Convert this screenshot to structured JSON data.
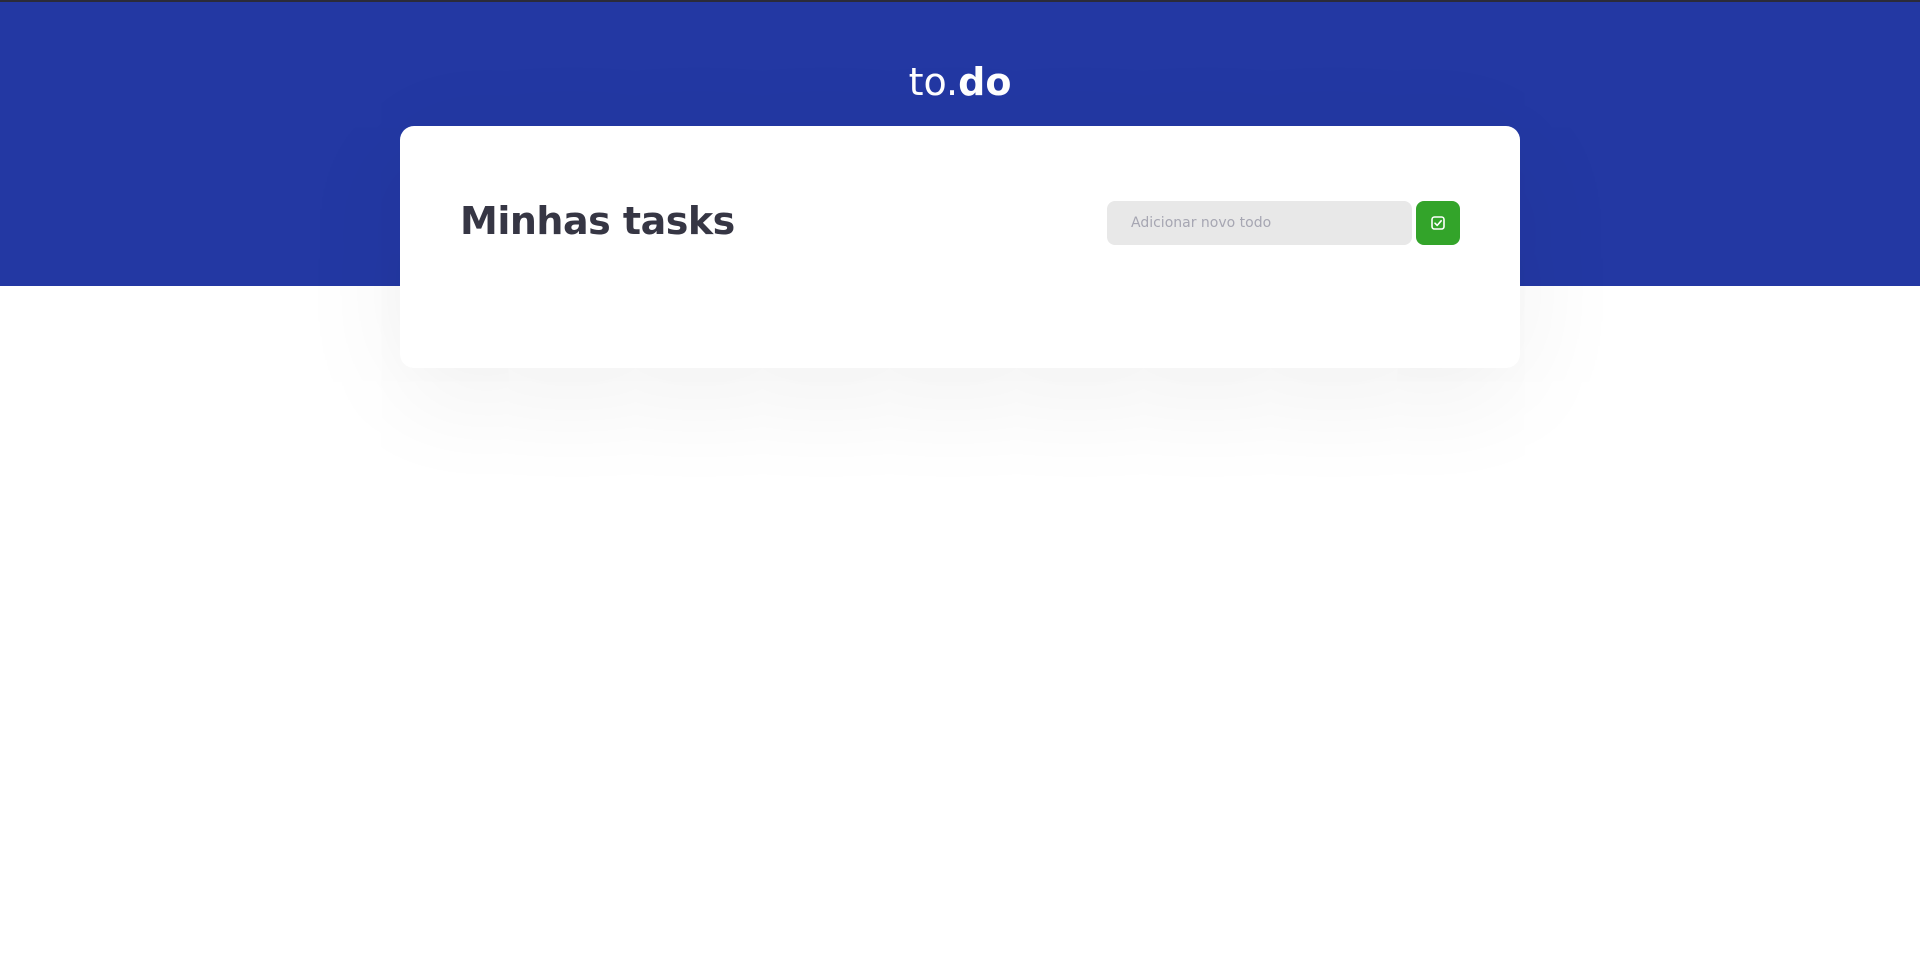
{
  "header": {
    "logo_light": "to.",
    "logo_bold": "do",
    "background_color": "#2338a3"
  },
  "main": {
    "title": "Minhas tasks",
    "new_todo": {
      "placeholder": "Adicionar novo todo",
      "value": ""
    },
    "add_button": {
      "icon": "check-square-icon",
      "color": "#33a42a"
    }
  }
}
